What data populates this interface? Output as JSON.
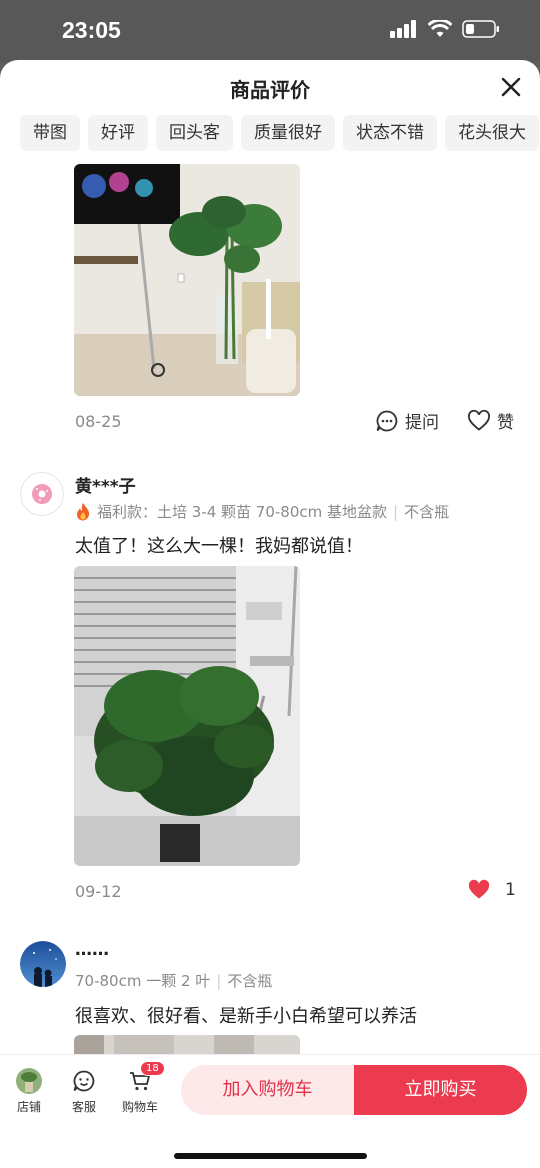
{
  "status_bar": {
    "time": "23:05"
  },
  "header": {
    "title": "商品评价"
  },
  "filter_chips": [
    "带图",
    "好评",
    "回头客",
    "质量很好",
    "状态不错",
    "花头很大"
  ],
  "reviews": [
    {
      "date": "08-25",
      "ask_label": "提问",
      "like_label": "赞"
    },
    {
      "username": "黄***子",
      "spec_tag": "福利款：土培 3-4 颗苗 70-80cm 基地盆款",
      "spec_extra": "不含瓶",
      "text": "太值了！这么大一棵！我妈都说值！",
      "date": "09-12",
      "like_count": "1"
    },
    {
      "username": "……",
      "spec_tag": "70-80cm 一颗 2 叶",
      "spec_extra": "不含瓶",
      "text": "很喜欢、很好看、是新手小白希望可以养活"
    }
  ],
  "bottom_nav": {
    "shop_label": "店铺",
    "service_label": "客服",
    "cart_label": "购物车",
    "cart_badge": "18",
    "add_to_cart_label": "加入购物车",
    "buy_now_label": "立即购买"
  },
  "colors": {
    "accent": "#ec3a4e",
    "accent_light": "#fde8ea",
    "muted_text": "#8a8a8a"
  }
}
